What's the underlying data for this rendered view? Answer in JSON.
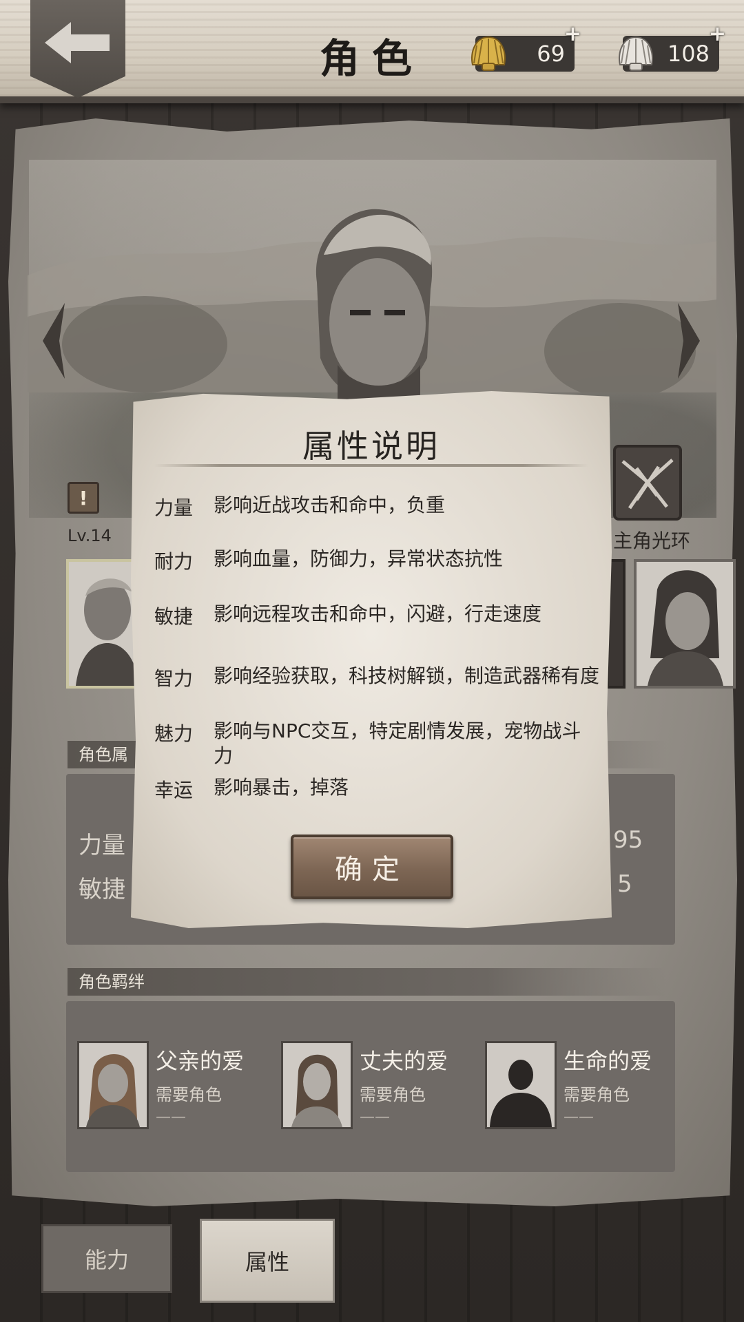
{
  "header": {
    "title": "角色",
    "currency_gold": {
      "value": "69",
      "plus": "+"
    },
    "currency_white": {
      "value": "108",
      "plus": "+"
    }
  },
  "character": {
    "level": "Lv.14",
    "warning": "!",
    "aura_label": "主角光环"
  },
  "sections": {
    "attributes_label": "角色属",
    "bonds_label": "角色羁绊"
  },
  "attributes_peek": {
    "left1": "力量",
    "left2": "敏捷",
    "right1": "95",
    "right2": "5"
  },
  "bonds": [
    {
      "name": "父亲的爱",
      "need": "需要角色",
      "dash": "——"
    },
    {
      "name": "丈夫的爱",
      "need": "需要角色",
      "dash": "——"
    },
    {
      "name": "生命的爱",
      "need": "需要角色",
      "dash": "——"
    }
  ],
  "tabs": {
    "ability": "能力",
    "attributes": "属性"
  },
  "modal": {
    "title": "属性说明",
    "rows": [
      {
        "key": "力量",
        "desc": "影响近战攻击和命中，负重"
      },
      {
        "key": "耐力",
        "desc": "影响血量，防御力，异常状态抗性"
      },
      {
        "key": "敏捷",
        "desc": "影响远程攻击和命中，闪避，行走速度"
      },
      {
        "key": "智力",
        "desc": "影响经验获取，科技树解锁，制造武器稀有度"
      },
      {
        "key": "魅力",
        "desc": "影响与NPC交互，特定剧情发展，宠物战斗力"
      },
      {
        "key": "幸运",
        "desc": "影响暴击，掉落"
      }
    ],
    "confirm": "确定"
  },
  "icons": {
    "back": "arrow-left-icon",
    "gold_shell": "gold-shell-icon",
    "white_shell": "white-shell-icon",
    "prev": "chevron-left-icon",
    "next": "chevron-right-icon",
    "aura": "aura-icon"
  }
}
